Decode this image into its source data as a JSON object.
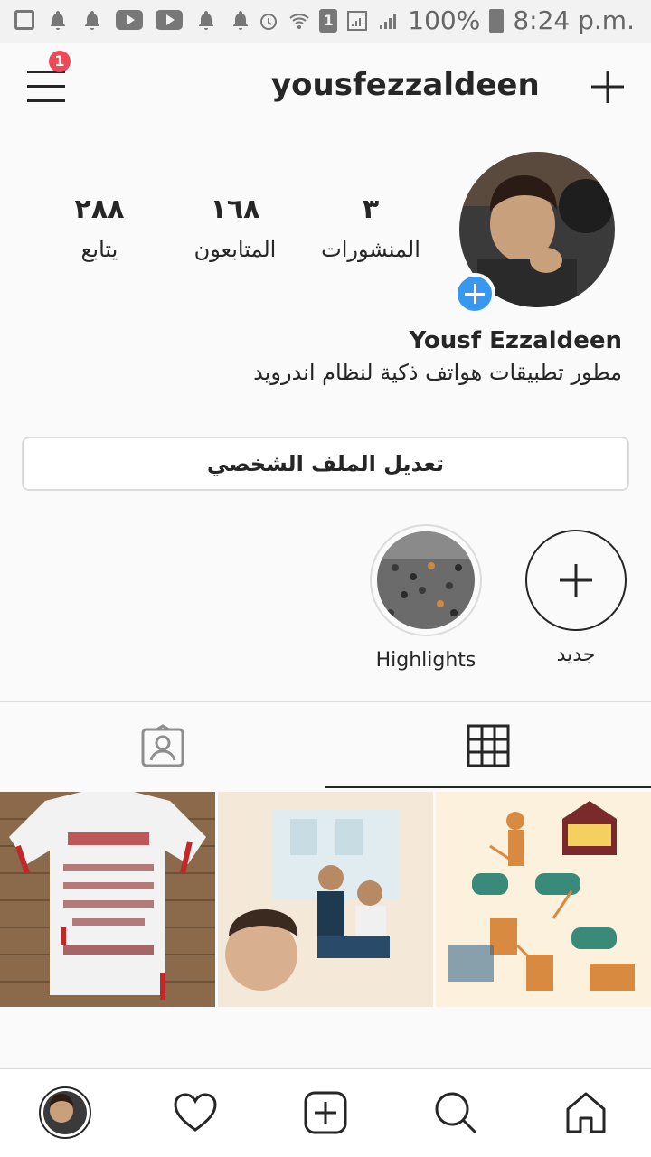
{
  "status_bar": {
    "battery": "100%",
    "time": "8:24 p.m.",
    "sim": "1"
  },
  "header": {
    "username": "yousfezzaldeen",
    "notification_count": "1"
  },
  "profile": {
    "stats": [
      {
        "value": "٢٨٨",
        "label": "يتابع"
      },
      {
        "value": "١٦٨",
        "label": "المتابعون"
      },
      {
        "value": "٣",
        "label": "المنشورات"
      }
    ],
    "full_name": "Yousf Ezzaldeen",
    "bio": "مطور تطبيقات هواتف ذكية لنظام اندرويد",
    "edit_button": "تعديل الملف الشخصي"
  },
  "highlights": [
    {
      "label": "Highlights"
    },
    {
      "label": "جديد"
    }
  ],
  "colors": {
    "accent": "#3897f0",
    "badge": "#ed4956",
    "text": "#262626",
    "border": "#dbdbdb"
  }
}
